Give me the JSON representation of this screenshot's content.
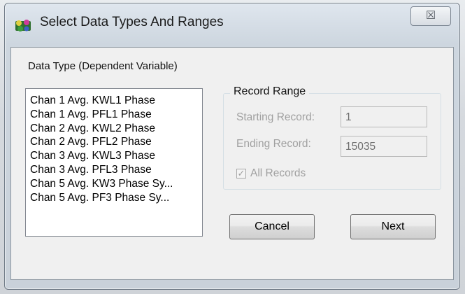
{
  "window": {
    "title": "Select Data Types And Ranges",
    "close_glyph": "☒"
  },
  "data_type": {
    "label": "Data Type (Dependent Variable)",
    "items": [
      "Chan 1 Avg. KWL1 Phase",
      "Chan 1 Avg. PFL1 Phase",
      "Chan 2 Avg. KWL2 Phase",
      "Chan 2 Avg. PFL2 Phase",
      "Chan 3 Avg. KWL3 Phase",
      "Chan 3 Avg. PFL3 Phase",
      "Chan 5 Avg. KW3 Phase Sy...",
      "Chan 5 Avg. PF3 Phase Sy..."
    ]
  },
  "record_range": {
    "title": "Record Range",
    "starting_label": "Starting Record:",
    "starting_value": "1",
    "ending_label": "Ending Record:",
    "ending_value": "15035",
    "all_records_label": "All Records",
    "all_records_checked": true
  },
  "buttons": {
    "cancel": "Cancel",
    "next": "Next"
  },
  "icons": {
    "app": "app-icon",
    "close": "close-icon",
    "check": "checkmark-icon"
  }
}
